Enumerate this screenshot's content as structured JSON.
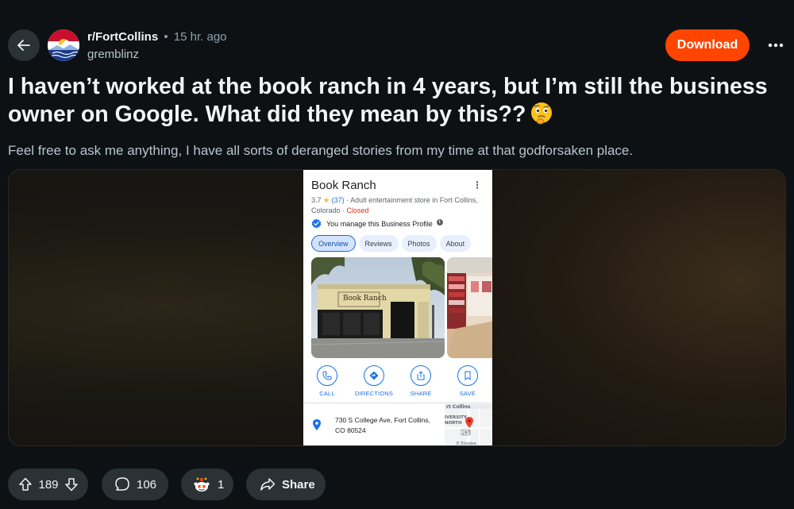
{
  "post": {
    "subreddit": "r/FortCollins",
    "separator": "•",
    "time": "15 hr. ago",
    "author": "gremblinz",
    "title": "I haven’t worked at the book ranch in 4 years, but I’m still the business owner on Google. What did they mean by this??",
    "title_emoji": "thinking-face-emoji",
    "body": "Feel free to ask me anything, I have all sorts of deranged stories from my time at that godforsaken place."
  },
  "header": {
    "download_label": "Download",
    "back_icon": "arrow-left-icon",
    "more_icon": "more-horizontal-icon"
  },
  "screenshot": {
    "business_name": "Book Ranch",
    "rating": "3.7",
    "star": "★",
    "review_count": "(37)",
    "category_text": "· Adult entertainment store in Fort Collins, Colorado ·",
    "status": "Closed",
    "manage_text": "You manage this Business Profile",
    "info_glyph": "i",
    "more_glyph": "⋮",
    "tabs": [
      "Overview",
      "Reviews",
      "Photos",
      "About"
    ],
    "actions": [
      {
        "label": "CALL",
        "icon": "phone-icon"
      },
      {
        "label": "DIRECTIONS",
        "icon": "directions-icon"
      },
      {
        "label": "SHARE",
        "icon": "share-icon"
      },
      {
        "label": "SAVE",
        "icon": "bookmark-icon"
      }
    ],
    "address_line1": "730 S College Ave, Fort Collins,",
    "address_line2": "CO 80524",
    "map_labels": {
      "top": "rt Collins",
      "street1": "IVERSITY",
      "street2": "NORTH",
      "route": "287",
      "bottom": "E Elizabe"
    },
    "sign_text": "Book Ranch"
  },
  "footer": {
    "upvotes": "189",
    "comments": "106",
    "awards": "1",
    "share_label": "Share"
  },
  "colors": {
    "background": "#0e1113",
    "accent": "#ff4500",
    "pill": "#2a3236",
    "google_blue": "#1a73e8"
  }
}
